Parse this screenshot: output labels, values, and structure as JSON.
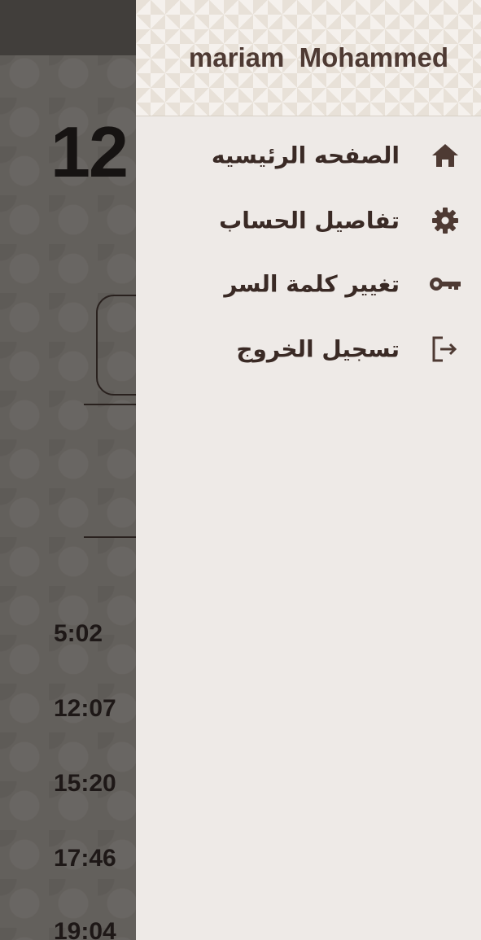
{
  "background": {
    "clock_partial": "12",
    "prayer_times": [
      "5:02",
      "12:07",
      "15:20",
      "17:46",
      "19:04"
    ]
  },
  "drawer": {
    "username": "mariam  Mohammed",
    "items": [
      {
        "label": "الصفحه الرئيسيه",
        "icon": "home-icon"
      },
      {
        "label": "تفاصيل الحساب",
        "icon": "gear-icon"
      },
      {
        "label": "تغيير كلمة السر",
        "icon": "key-icon"
      },
      {
        "label": "تسجيل الخروج",
        "icon": "logout-icon"
      }
    ]
  },
  "colors": {
    "accent": "#4e3a33",
    "drawer_bg": "#eeeae7"
  }
}
